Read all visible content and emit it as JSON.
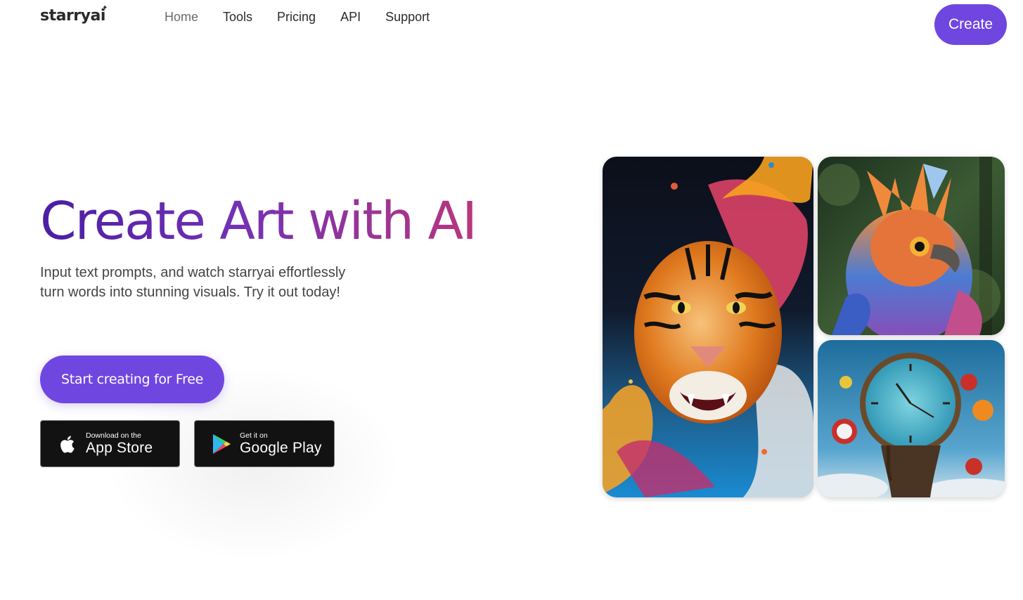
{
  "header": {
    "logo": "starryai",
    "logo_spark": "✦",
    "nav": [
      {
        "label": "Home",
        "active": true
      },
      {
        "label": "Tools",
        "active": false
      },
      {
        "label": "Pricing",
        "active": false
      },
      {
        "label": "API",
        "active": false
      },
      {
        "label": "Support",
        "active": false
      }
    ],
    "create_label": "Create"
  },
  "hero": {
    "title": "Create Art with AI",
    "subtitle_line1": "Input text prompts, and watch starryai effortlessly",
    "subtitle_line2": "turn words into stunning visuals. Try it out today!",
    "cta_label": "Start creating for Free"
  },
  "stores": {
    "apple": {
      "small": "Download on the",
      "big": "App Store",
      "icon": "apple-icon"
    },
    "google": {
      "small": "Get it on",
      "big": "Google Play",
      "icon": "google-play-icon"
    }
  },
  "gallery": [
    {
      "name": "tiger-artwork",
      "subject": "tiger"
    },
    {
      "name": "bird-artwork",
      "subject": "bird"
    },
    {
      "name": "melting-clock-artwork",
      "subject": "clock"
    }
  ],
  "colors": {
    "brand": "#7046e0",
    "title_gradient_start": "#4a1ea3",
    "title_gradient_end": "#b9367d",
    "store_bg": "#121212"
  }
}
